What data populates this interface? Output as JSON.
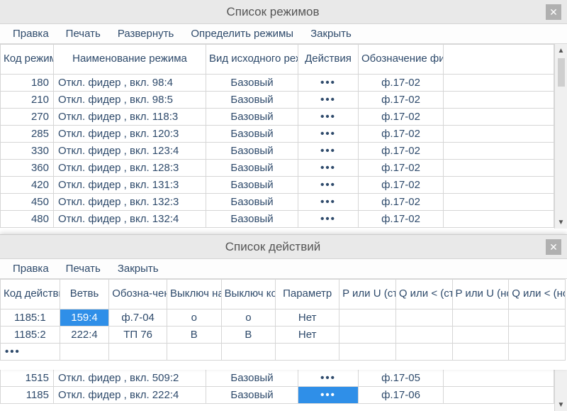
{
  "win1": {
    "title": "Список режимов",
    "menu": [
      "Правка",
      "Печать",
      "Развернуть",
      "Определить режимы",
      "Закрыть"
    ],
    "headers": [
      "Код режима",
      "Наименование режима",
      "Вид исходного режима",
      "Действия",
      "Обозначение фидера"
    ],
    "rows": [
      {
        "code": "180",
        "name": "Откл. фидер , вкл. 98:4",
        "type": "Базовый",
        "act": "•••",
        "feeder": "ф.17-02"
      },
      {
        "code": "210",
        "name": "Откл. фидер , вкл. 98:5",
        "type": "Базовый",
        "act": "•••",
        "feeder": "ф.17-02"
      },
      {
        "code": "270",
        "name": "Откл. фидер , вкл. 118:3",
        "type": "Базовый",
        "act": "•••",
        "feeder": "ф.17-02"
      },
      {
        "code": "285",
        "name": "Откл. фидер , вкл. 120:3",
        "type": "Базовый",
        "act": "•••",
        "feeder": "ф.17-02"
      },
      {
        "code": "330",
        "name": "Откл. фидер , вкл. 123:4",
        "type": "Базовый",
        "act": "•••",
        "feeder": "ф.17-02"
      },
      {
        "code": "360",
        "name": "Откл. фидер , вкл. 128:3",
        "type": "Базовый",
        "act": "•••",
        "feeder": "ф.17-02"
      },
      {
        "code": "420",
        "name": "Откл. фидер , вкл. 131:3",
        "type": "Базовый",
        "act": "•••",
        "feeder": "ф.17-02"
      },
      {
        "code": "450",
        "name": "Откл. фидер , вкл. 132:3",
        "type": "Базовый",
        "act": "•••",
        "feeder": "ф.17-02"
      },
      {
        "code": "480",
        "name": "Откл. фидер , вкл. 132:4",
        "type": "Базовый",
        "act": "•••",
        "feeder": "ф.17-02"
      }
    ],
    "tail": [
      {
        "code": "1515",
        "name": "Откл. фидер , вкл. 509:2",
        "type": "Базовый",
        "act": "•••",
        "feeder": "ф.17-05",
        "sel": false
      },
      {
        "code": "1185",
        "name": "Откл. фидер , вкл. 222:4",
        "type": "Базовый",
        "act": "•••",
        "feeder": "ф.17-06",
        "sel": true
      }
    ]
  },
  "win2": {
    "title": "Список действий",
    "menu": [
      "Правка",
      "Печать",
      "Закрыть"
    ],
    "headers": [
      "Код действия",
      "Ветвь",
      "Обозна-чение",
      "Выключ начала",
      "Выключ конца",
      "Параметр",
      "P или U (стар.)",
      "Q или < (стар.)",
      "P или U (нов.)",
      "Q или < (нов.)"
    ],
    "rows": [
      {
        "code": "1185:1",
        "branch": "159:4",
        "desig": "ф.7-04",
        "sw1": "о",
        "sw2": "о",
        "param": "Нет",
        "sel": true
      },
      {
        "code": "1185:2",
        "branch": "222:4",
        "desig": "ТП 76",
        "sw1": "В",
        "sw2": "В",
        "param": "Нет",
        "sel": false
      }
    ],
    "more": "•••"
  }
}
